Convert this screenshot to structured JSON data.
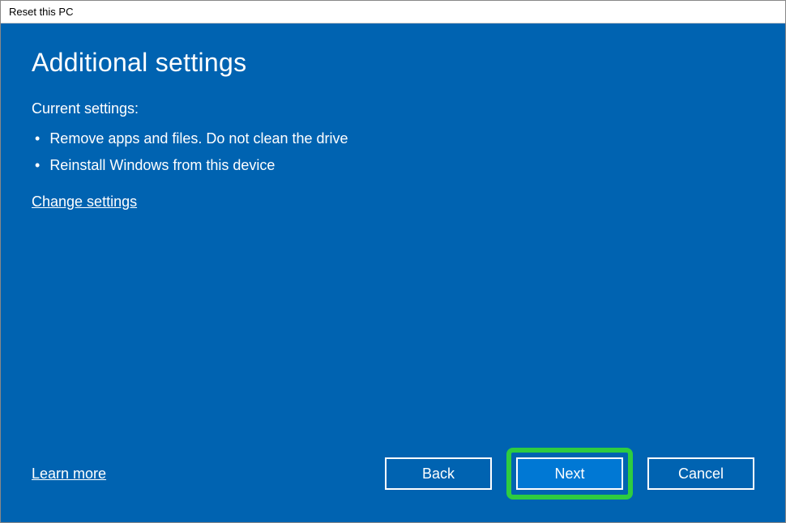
{
  "window": {
    "title": "Reset this PC"
  },
  "main": {
    "heading": "Additional settings",
    "subheading": "Current settings:",
    "bullets": [
      "Remove apps and files. Do not clean the drive",
      "Reinstall Windows from this device"
    ],
    "change_link": "Change settings"
  },
  "footer": {
    "learn_more": "Learn more",
    "back": "Back",
    "next": "Next",
    "cancel": "Cancel"
  }
}
